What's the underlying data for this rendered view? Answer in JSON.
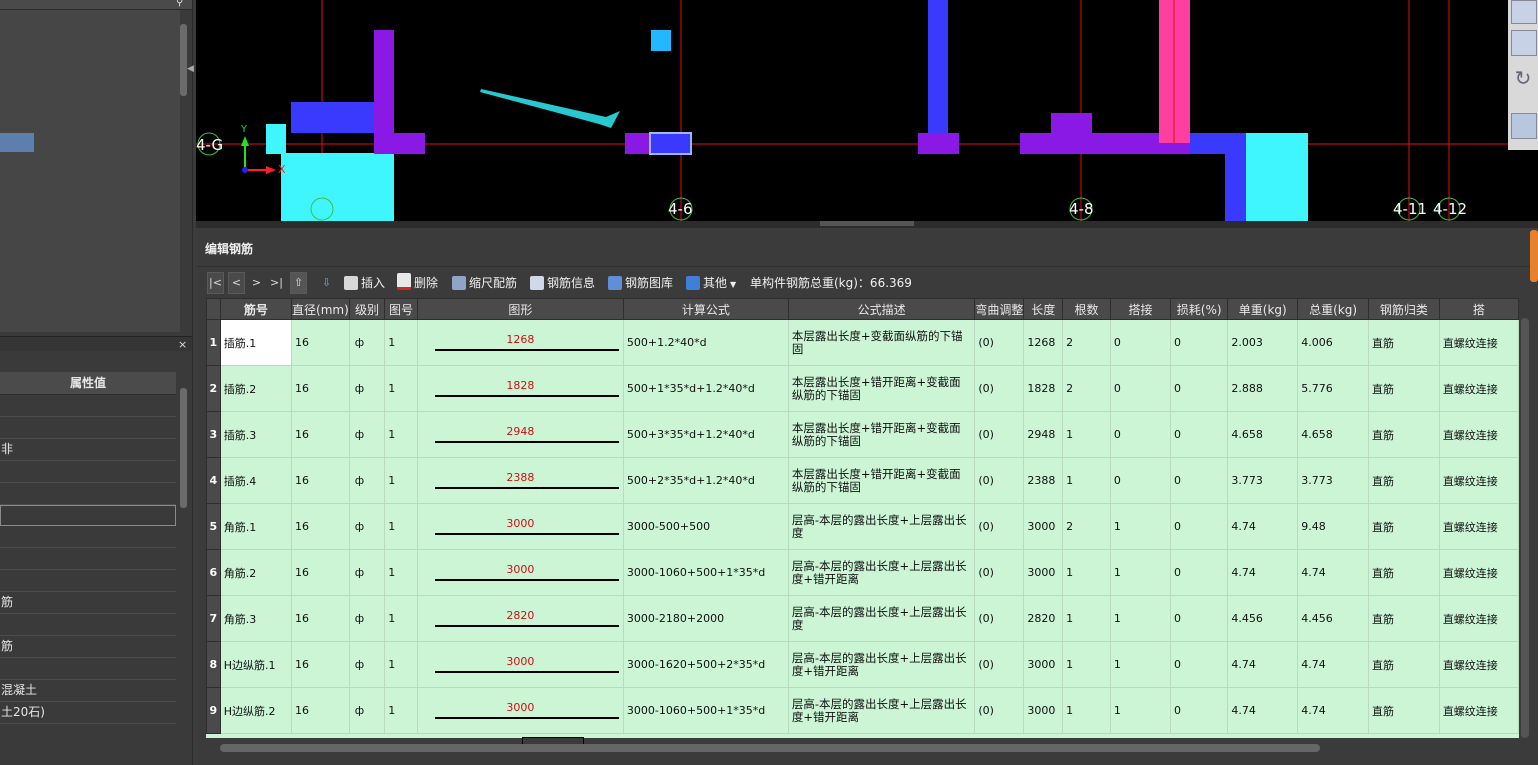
{
  "left_panel": {
    "property_header": "属性值",
    "property_values": [
      "",
      "",
      "非",
      "",
      "",
      "",
      "",
      "",
      "",
      "筋",
      "",
      "筋",
      "",
      "混凝土",
      "土20石)"
    ]
  },
  "cad": {
    "axis_labels": {
      "row": "4-G",
      "c1": "4-6",
      "c2": "4-8",
      "c3": "4-11",
      "c4": "4-12"
    },
    "ucs": {
      "x": "X",
      "y": "Y"
    },
    "colors": {
      "purple": "#8a19e6",
      "blue": "#3a3aff",
      "cyan": "#3ff6ff",
      "pink": "#ff3ea0",
      "red": "#e01010",
      "arrow": "#27c8cf"
    }
  },
  "panel": {
    "title": "编辑钢筋",
    "toolbar": {
      "nav_first": "|<",
      "nav_prev": "<",
      "nav_next": ">",
      "nav_last": ">|",
      "insert": "插入",
      "delete": "删除",
      "scale": "缩尺配筋",
      "info": "钢筋信息",
      "library": "钢筋图库",
      "other": "其他",
      "total_label": "单构件钢筋总重(kg)：66.369"
    },
    "columns": [
      "",
      "筋号",
      "直径(mm)",
      "级别",
      "图号",
      "图形",
      "计算公式",
      "公式描述",
      "弯曲调整",
      "长度",
      "根数",
      "搭接",
      "损耗(%)",
      "单重(kg)",
      "总重(kg)",
      "钢筋归类",
      "搭"
    ],
    "rows": [
      {
        "n": "1",
        "name": "插筋.1",
        "dia": "16",
        "grade": "ф",
        "fig": "1",
        "shape": "1268",
        "formula": "500+1.2*40*d",
        "desc": "本层露出长度+变截面纵筋的下锚固",
        "bend": "(0)",
        "len": "1268",
        "count": "2",
        "lap": "0",
        "loss": "0",
        "unit": "2.003",
        "total": "4.006",
        "cat": "直筋",
        "conn": "直螺纹连接"
      },
      {
        "n": "2",
        "name": "插筋.2",
        "dia": "16",
        "grade": "ф",
        "fig": "1",
        "shape": "1828",
        "formula": "500+1*35*d+1.2*40*d",
        "desc": "本层露出长度+错开距离+变截面纵筋的下锚固",
        "bend": "(0)",
        "len": "1828",
        "count": "2",
        "lap": "0",
        "loss": "0",
        "unit": "2.888",
        "total": "5.776",
        "cat": "直筋",
        "conn": "直螺纹连接"
      },
      {
        "n": "3",
        "name": "插筋.3",
        "dia": "16",
        "grade": "ф",
        "fig": "1",
        "shape": "2948",
        "formula": "500+3*35*d+1.2*40*d",
        "desc": "本层露出长度+错开距离+变截面纵筋的下锚固",
        "bend": "(0)",
        "len": "2948",
        "count": "1",
        "lap": "0",
        "loss": "0",
        "unit": "4.658",
        "total": "4.658",
        "cat": "直筋",
        "conn": "直螺纹连接"
      },
      {
        "n": "4",
        "name": "插筋.4",
        "dia": "16",
        "grade": "ф",
        "fig": "1",
        "shape": "2388",
        "formula": "500+2*35*d+1.2*40*d",
        "desc": "本层露出长度+错开距离+变截面纵筋的下锚固",
        "bend": "(0)",
        "len": "2388",
        "count": "1",
        "lap": "0",
        "loss": "0",
        "unit": "3.773",
        "total": "3.773",
        "cat": "直筋",
        "conn": "直螺纹连接"
      },
      {
        "n": "5",
        "name": "角筋.1",
        "dia": "16",
        "grade": "ф",
        "fig": "1",
        "shape": "3000",
        "formula": "3000-500+500",
        "desc": "层高-本层的露出长度+上层露出长度",
        "bend": "(0)",
        "len": "3000",
        "count": "2",
        "lap": "1",
        "loss": "0",
        "unit": "4.74",
        "total": "9.48",
        "cat": "直筋",
        "conn": "直螺纹连接"
      },
      {
        "n": "6",
        "name": "角筋.2",
        "dia": "16",
        "grade": "ф",
        "fig": "1",
        "shape": "3000",
        "formula": "3000-1060+500+1*35*d",
        "desc": "层高-本层的露出长度+上层露出长度+错开距离",
        "bend": "(0)",
        "len": "3000",
        "count": "1",
        "lap": "1",
        "loss": "0",
        "unit": "4.74",
        "total": "4.74",
        "cat": "直筋",
        "conn": "直螺纹连接"
      },
      {
        "n": "7",
        "name": "角筋.3",
        "dia": "16",
        "grade": "ф",
        "fig": "1",
        "shape": "2820",
        "formula": "3000-2180+2000",
        "desc": "层高-本层的露出长度+上层露出长度",
        "bend": "(0)",
        "len": "2820",
        "count": "1",
        "lap": "1",
        "loss": "0",
        "unit": "4.456",
        "total": "4.456",
        "cat": "直筋",
        "conn": "直螺纹连接"
      },
      {
        "n": "8",
        "name": "H边纵筋.1",
        "dia": "16",
        "grade": "ф",
        "fig": "1",
        "shape": "3000",
        "formula": "3000-1620+500+2*35*d",
        "desc": "层高-本层的露出长度+上层露出长度+错开距离",
        "bend": "(0)",
        "len": "3000",
        "count": "1",
        "lap": "1",
        "loss": "0",
        "unit": "4.74",
        "total": "4.74",
        "cat": "直筋",
        "conn": "直螺纹连接"
      },
      {
        "n": "9",
        "name": "H边纵筋.2",
        "dia": "16",
        "grade": "ф",
        "fig": "1",
        "shape": "3000",
        "formula": "3000-1060+500+1*35*d",
        "desc": "层高-本层的露出长度+上层露出长度+错开距离",
        "bend": "(0)",
        "len": "3000",
        "count": "1",
        "lap": "1",
        "loss": "0",
        "unit": "4.74",
        "total": "4.74",
        "cat": "直筋",
        "conn": "直螺纹连接"
      }
    ]
  }
}
